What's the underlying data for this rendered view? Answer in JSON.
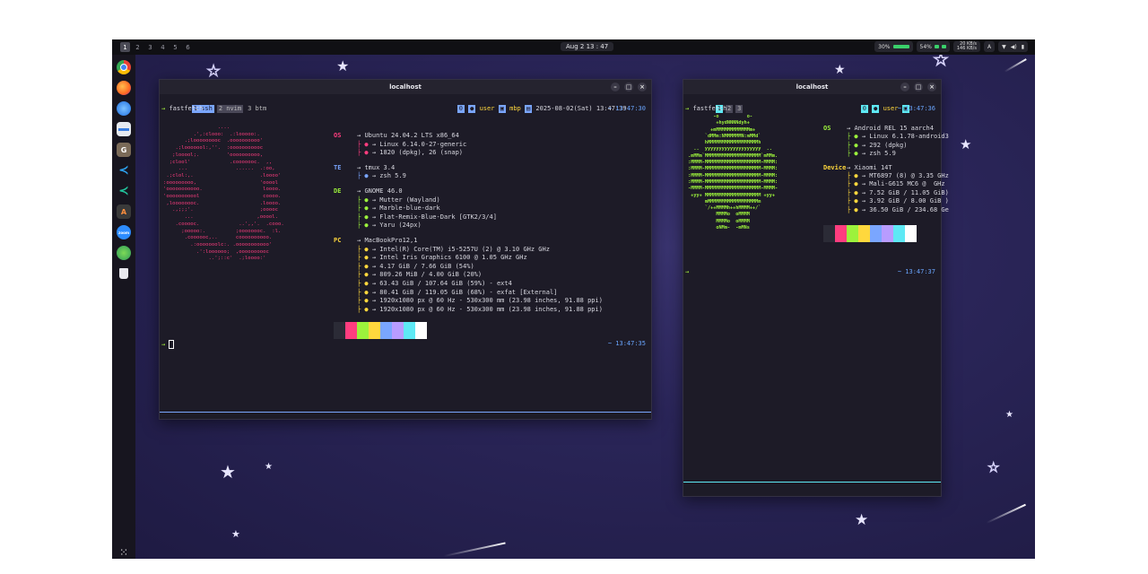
{
  "topbar": {
    "workspaces": [
      "1",
      "2",
      "3",
      "4",
      "5",
      "6"
    ],
    "clock": "Aug 2 13 : 47",
    "battery1": "30%",
    "battery2": "54%",
    "net_up": "20 KB/s",
    "net_down": "146 KB/s",
    "lang": "A"
  },
  "dock": {
    "apps": [
      "chrome-icon",
      "firefox-icon",
      "thunderbird-icon",
      "files-icon",
      "gimp-icon",
      "vscode-icon",
      "vscode-insiders-icon",
      "typora-icon",
      "zoom-icon",
      "android-studio-icon",
      "trash-icon"
    ]
  },
  "left_window": {
    "title": "localhost",
    "tabs": [
      {
        "num": "1",
        "label": "ssh"
      },
      {
        "num": "2",
        "label": "nvim"
      },
      {
        "num": "3",
        "label": "btm"
      }
    ],
    "status": {
      "win": "0",
      "user": "user",
      "host": "mbp",
      "datetime": "2025-08-02(Sat) 13:47:39"
    },
    "command": "fastfetch",
    "time1": "~ 13:47:30",
    "time2": "~ 13:47:35",
    "logo_ascii": "                  ....\n          .',:clooo:  .:looooo:.\n       .;looooooooc  .oooooooooo'\n    .;looooool:,''.  :ooooooooooc\n   ;looool;.         'oooooooooo,\n  ;clool'             .cooooooc.  ,,\n     ...                ......  .:oo,\n .;clol:,.                      .loooo'\n:ooooooooo,                     'ooool\n'ooooooooooo.                    loooo.\n'ooooooooool                     coooo.\n ,loooooooc.                    .loooo.\n   .,;;;'.                      ;ooooc\n       ...                     ,ooool.\n    .cooooc.             ..',,'.  .cooo.\n      ;ooooo:.          ;oooooooc.  :l.\n       .coooooc,..      coooooooooo.\n         .:ooooooolc:. .ooooooooooo'\n           .':loooooo;  ,oooooooooc\n               ..';::c'  .;loooo:'",
    "info": [
      {
        "key": "OS",
        "value": "Ubuntu 24.04.2 LTS x86_64",
        "color": "k"
      },
      {
        "key": "",
        "value": "Linux 6.14.0-27-generic",
        "color": "k"
      },
      {
        "key": "",
        "value": "1820 (dpkg), 26 (snap)",
        "color": "k"
      },
      {
        "key": "TE",
        "value": "tmux 3.4",
        "color": "kb"
      },
      {
        "key": "",
        "value": "zsh 5.9",
        "color": "kb"
      },
      {
        "key": "DE",
        "value": "GNOME 46.0",
        "color": "kg"
      },
      {
        "key": "",
        "value": "Mutter (Wayland)",
        "color": "kg"
      },
      {
        "key": "",
        "value": "Marble-blue-dark",
        "color": "kg"
      },
      {
        "key": "",
        "value": "Flat-Remix-Blue-Dark [GTK2/3/4]",
        "color": "kg"
      },
      {
        "key": "",
        "value": "Yaru (24px)",
        "color": "kg"
      },
      {
        "key": "PC",
        "value": "MacBookPro12,1",
        "color": "ky"
      },
      {
        "key": "",
        "value": "Intel(R) Core(TM) i5-5257U (2) @ 3.10 GHz GHz",
        "color": "ky"
      },
      {
        "key": "",
        "value": "Intel Iris Graphics 6100 @ 1.05 GHz GHz",
        "color": "ky"
      },
      {
        "key": "",
        "value": "4.17 GiB / 7.66 GiB (54%)",
        "color": "ky"
      },
      {
        "key": "",
        "value": "809.26 MiB / 4.00 GiB (20%)",
        "color": "ky"
      },
      {
        "key": "",
        "value": "63.43 GiB / 107.64 GiB (59%) - ext4",
        "color": "ky"
      },
      {
        "key": "",
        "value": "80.41 GiB / 119.05 GiB (68%) - exfat [External]",
        "color": "ky"
      },
      {
        "key": "",
        "value": "1920x1080 px @ 60 Hz - 530x300 mm (23.98 inches, 91.88 ppi)",
        "color": "ky"
      },
      {
        "key": "",
        "value": "1920x1080 px @ 60 Hz - 530x300 mm (23.98 inches, 91.88 ppi)",
        "color": "ky"
      }
    ],
    "palette": [
      "#2b2b36",
      "#ff3d7f",
      "#9cf23c",
      "#ffd83d",
      "#7aa6ff",
      "#b89cff",
      "#5ee9f5",
      "#ffffff"
    ]
  },
  "right_window": {
    "title": "localhost",
    "tabs": [
      "1",
      "2",
      "3"
    ],
    "status": {
      "win": "0",
      "user": "user"
    },
    "command": "fastfetch",
    "time1": "~ 13:47:36",
    "time2": "~ 13:47:37",
    "logo_ascii": "          -o          o-\n           +hydNNNNdyh+\n         +mMMMMMMMMMMMMm+\n       `dMMm:NMMMMMMN:mMMd`\n       hMMMMMMMMMMMMMMMMMMh\n   ..  yyyyyyyyyyyyyyyyyyyy  ..\n .mMMm`MMMMMMMMMMMMMMMMMMMM`mMMm.\n :MMMM-MMMMMMMMMMMMMMMMMMMM-MMMM:\n :MMMM-MMMMMMMMMMMMMMMMMMMM-MMMM:\n :MMMM-MMMMMMMMMMMMMMMMMMMM-MMMM:\n :MMMM-MMMMMMMMMMMMMMMMMMMM-MMMM:\n -MMMM-MMMMMMMMMMMMMMMMMMMM-MMMM-\n  +yy+ MMMMMMMMMMMMMMMMMMMM +yy+\n       mMMMMMMMMMMMMMMMMMMm\n       `/++MMMMh++hMMMM++/`\n           MMMMo  oMMMM\n           MMMMo  oMMMM\n           oNMm-  -mMNs",
    "info": [
      {
        "key": "OS",
        "value": "Android REL 15 aarch4",
        "color": "kg"
      },
      {
        "key": "",
        "value": "Linux 6.1.78-android3",
        "color": "kg"
      },
      {
        "key": "",
        "value": "292 (dpkg)",
        "color": "kg"
      },
      {
        "key": "",
        "value": "zsh 5.9",
        "color": "kg"
      },
      {
        "key": "Device",
        "value": "Xiaomi 14T",
        "color": "ky"
      },
      {
        "key": "",
        "value": "MT6897 (8) @ 3.35 GHz",
        "color": "ky"
      },
      {
        "key": "",
        "value": "Mali-G615 MC6 @  GHz",
        "color": "ky"
      },
      {
        "key": "",
        "value": "7.52 GiB / 11.05 GiB)",
        "color": "ky"
      },
      {
        "key": "",
        "value": "3.92 GiB / 8.00 GiB )",
        "color": "ky"
      },
      {
        "key": "",
        "value": "36.50 GiB / 234.68 Ge",
        "color": "ky"
      }
    ],
    "palette": [
      "#2b2b36",
      "#ff3d7f",
      "#9cf23c",
      "#ffd83d",
      "#7aa6ff",
      "#b89cff",
      "#5ee9f5",
      "#ffffff"
    ]
  }
}
